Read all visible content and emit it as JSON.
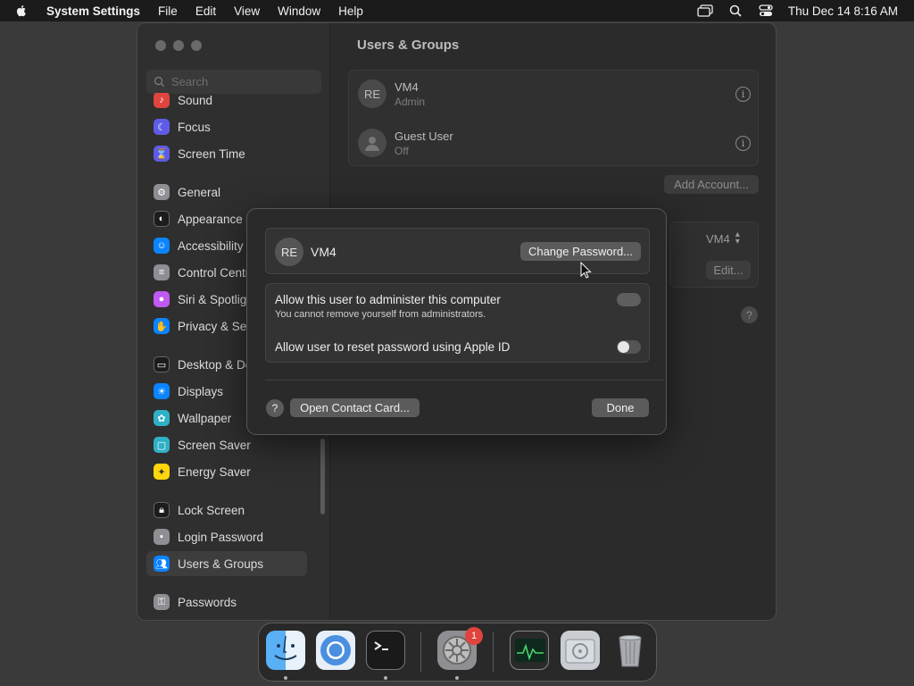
{
  "menubar": {
    "app_name": "System Settings",
    "menus": [
      "File",
      "Edit",
      "View",
      "Window",
      "Help"
    ],
    "clock": "Thu Dec 14  8:16 AM"
  },
  "sidebar": {
    "search_placeholder": "Search",
    "items": [
      {
        "label": "Sound",
        "icon": "speaker-icon",
        "color": "#e0443e"
      },
      {
        "label": "Focus",
        "icon": "moon-icon",
        "color": "#5e5ce6"
      },
      {
        "label": "Screen Time",
        "icon": "hourglass-icon",
        "color": "#5e5ce6"
      },
      {
        "label": "General",
        "icon": "gear-icon",
        "color": "#8e8e93"
      },
      {
        "label": "Appearance",
        "icon": "appearance-icon",
        "color": "#1c1c1e"
      },
      {
        "label": "Accessibility",
        "icon": "accessibility-icon",
        "color": "#0a84ff"
      },
      {
        "label": "Control Centre",
        "icon": "control-centre-icon",
        "color": "#8e8e93"
      },
      {
        "label": "Siri & Spotlight",
        "icon": "siri-icon",
        "color": "#bf5af2"
      },
      {
        "label": "Privacy & Security",
        "icon": "hand-icon",
        "color": "#0a84ff"
      },
      {
        "label": "Desktop & Dock",
        "icon": "dock-icon",
        "color": "#1c1c1e"
      },
      {
        "label": "Displays",
        "icon": "sun-icon",
        "color": "#0a84ff"
      },
      {
        "label": "Wallpaper",
        "icon": "wallpaper-icon",
        "color": "#30b0c7"
      },
      {
        "label": "Screen Saver",
        "icon": "screen-saver-icon",
        "color": "#30b0c7"
      },
      {
        "label": "Energy Saver",
        "icon": "lightbulb-icon",
        "color": "#ffd60a"
      },
      {
        "label": "Lock Screen",
        "icon": "lock-icon",
        "color": "#1c1c1e"
      },
      {
        "label": "Login Password",
        "icon": "login-password-icon",
        "color": "#8e8e93"
      },
      {
        "label": "Users & Groups",
        "icon": "users-icon",
        "color": "#0a84ff"
      },
      {
        "label": "Passwords",
        "icon": "key-icon",
        "color": "#8e8e93"
      }
    ]
  },
  "main": {
    "title": "Users & Groups",
    "accounts": [
      {
        "initials": "RE",
        "name": "VM4",
        "role": "Admin"
      },
      {
        "initials": "",
        "name": "Guest User",
        "role": "Off"
      }
    ],
    "add_account_label": "Add Account...",
    "auto_login_value": "VM4",
    "edit_label": "Edit..."
  },
  "sheet": {
    "avatar_initials": "RE",
    "user_name": "VM4",
    "change_password_label": "Change Password...",
    "option_admin_label": "Allow this user to administer this computer",
    "option_admin_sub": "You cannot remove yourself from administrators.",
    "option_reset_label": "Allow user to reset password using Apple ID",
    "option_reset_on": false,
    "help_label": "?",
    "open_contact_label": "Open Contact Card...",
    "done_label": "Done"
  },
  "dock": {
    "apps": [
      {
        "name": "Finder",
        "icon": "finder-icon",
        "running": true
      },
      {
        "name": "Chromium",
        "icon": "chromium-icon",
        "running": false
      },
      {
        "name": "Terminal",
        "icon": "terminal-icon",
        "running": true
      },
      {
        "name": "System Settings",
        "icon": "system-settings-icon",
        "running": true,
        "badge": "1"
      },
      {
        "name": "Activity Monitor",
        "icon": "activity-monitor-icon",
        "running": false
      },
      {
        "name": "Disk Utility",
        "icon": "disk-utility-icon",
        "running": false
      },
      {
        "name": "Trash",
        "icon": "trash-icon",
        "running": false
      }
    ]
  }
}
